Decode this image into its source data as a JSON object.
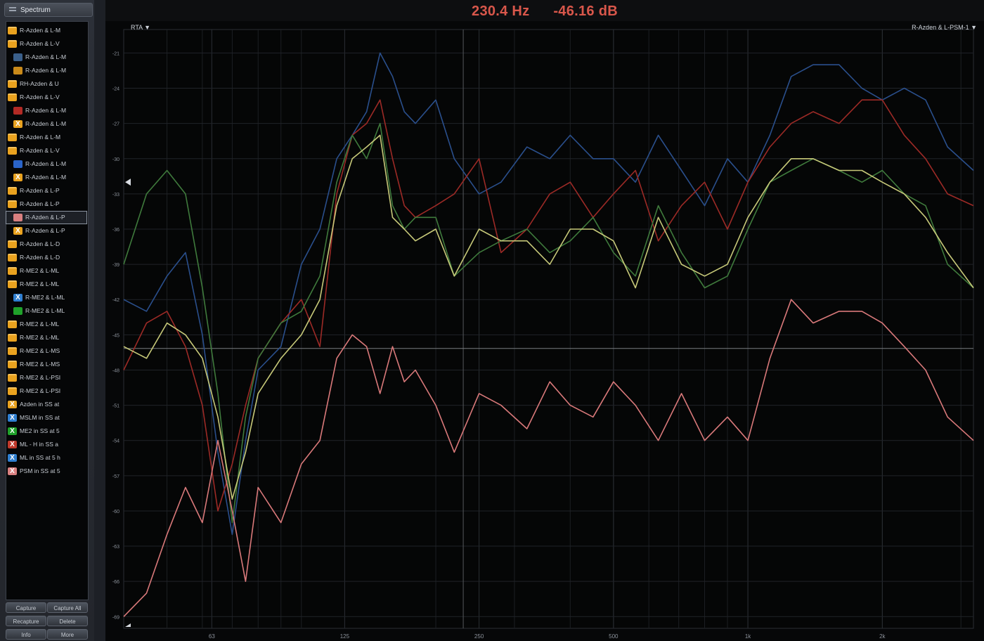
{
  "sidebar": {
    "title": "Spectrum",
    "items": [
      {
        "label": "R-Azden & L-M",
        "icon": "folder-icon",
        "color": "#e9a21f"
      },
      {
        "label": "R-Azden & L-V",
        "icon": "folder-icon",
        "color": "#e9a21f"
      },
      {
        "label": "R-Azden & L-M",
        "icon": "trace-swatch-icon",
        "color": "#3a5f8a",
        "indent": true
      },
      {
        "label": "R-Azden & L-M",
        "icon": "trace-swatch-icon",
        "color": "#c98a1a",
        "indent": true
      },
      {
        "label": "RH-Azden & U",
        "icon": "folder-icon",
        "color": "#e9a21f"
      },
      {
        "label": "R-Azden & L-V",
        "icon": "folder-icon",
        "color": "#e9a21f"
      },
      {
        "label": "R-Azden & L-M",
        "icon": "trace-swatch-icon",
        "color": "#b22a25",
        "indent": true
      },
      {
        "label": "R-Azden & L-M",
        "icon": "x-swatch-icon",
        "color": "#e9a21f",
        "indent": true
      },
      {
        "label": "R-Azden & L-M",
        "icon": "folder-icon",
        "color": "#e9a21f"
      },
      {
        "label": "R-Azden & L-V",
        "icon": "folder-icon",
        "color": "#e9a21f"
      },
      {
        "label": "R-Azden & L-M",
        "icon": "trace-swatch-icon",
        "color": "#2a64c8",
        "indent": true
      },
      {
        "label": "R-Azden & L-M",
        "icon": "x-swatch-icon",
        "color": "#e9a21f",
        "indent": true
      },
      {
        "label": "R-Azden & L-P",
        "icon": "folder-icon",
        "color": "#e9a21f"
      },
      {
        "label": "R-Azden & L-P",
        "icon": "folder-icon",
        "color": "#e9a21f"
      },
      {
        "label": "R-Azden & L-P",
        "icon": "trace-swatch-icon",
        "color": "#d98080",
        "indent": true,
        "selected": true
      },
      {
        "label": "R-Azden & L-P",
        "icon": "x-swatch-icon",
        "color": "#e9a21f",
        "indent": true
      },
      {
        "label": "R-Azden & L-D",
        "icon": "folder-icon",
        "color": "#e9a21f"
      },
      {
        "label": "R-Azden & L-D",
        "icon": "folder-icon",
        "color": "#e9a21f"
      },
      {
        "label": "R-ME2 & L-ML",
        "icon": "folder-icon",
        "color": "#e9a21f"
      },
      {
        "label": "R-ME2 & L-ML",
        "icon": "folder-icon",
        "color": "#e9a21f"
      },
      {
        "label": "R-ME2 & L-ML",
        "icon": "x-swatch-icon",
        "color": "#2f7fd0",
        "indent": true
      },
      {
        "label": "R-ME2 & L-ML",
        "icon": "trace-swatch-icon",
        "color": "#1fa12a",
        "indent": true
      },
      {
        "label": "R-ME2 & L-ML",
        "icon": "folder-icon",
        "color": "#e9a21f"
      },
      {
        "label": "R-ME2 & L-ML",
        "icon": "folder-icon",
        "color": "#e9a21f"
      },
      {
        "label": "R-ME2 & L-MS",
        "icon": "folder-icon",
        "color": "#e9a21f"
      },
      {
        "label": "R-ME2 & L-MS",
        "icon": "folder-icon",
        "color": "#e9a21f"
      },
      {
        "label": "R-ME2 & L-PSI",
        "icon": "folder-icon",
        "color": "#e9a21f"
      },
      {
        "label": "R-ME2 & L-PSI",
        "icon": "folder-icon",
        "color": "#e9a21f"
      },
      {
        "label": "Azden in SS at",
        "icon": "x-swatch-icon",
        "color": "#e9a21f"
      },
      {
        "label": "MSLM in SS at",
        "icon": "x-swatch-icon",
        "color": "#2f7fd0"
      },
      {
        "label": "ME2 in SS at 5",
        "icon": "x-swatch-icon",
        "color": "#1fa12a"
      },
      {
        "label": "ML - H in SS a",
        "icon": "x-swatch-icon",
        "color": "#c0392b"
      },
      {
        "label": "ML in SS at 5 h",
        "icon": "x-swatch-icon",
        "color": "#2f7fd0"
      },
      {
        "label": "PSM in SS at 5",
        "icon": "x-swatch-icon",
        "color": "#d98080"
      }
    ],
    "buttons": {
      "capture": "Capture",
      "capture_all": "Capture All",
      "recapture": "Recapture",
      "delete": "Delete",
      "info": "Info",
      "more": "More"
    }
  },
  "readout": {
    "frequency": "230.4 Hz",
    "level": "-46.16 dB"
  },
  "plot": {
    "left_dropdown": "RTA ▼",
    "right_dropdown": "R-Azden & L-PSM-1 ▼",
    "y_ticks": [
      "-21",
      "-24",
      "-27",
      "-30",
      "-33",
      "-36",
      "-39",
      "-42",
      "-45",
      "-48",
      "-51",
      "-54",
      "-57",
      "-60",
      "-63",
      "-66",
      "-69"
    ],
    "x_ticks": [
      "63",
      "125",
      "250",
      "500",
      "1k",
      "2k"
    ]
  },
  "chart_data": {
    "type": "line",
    "xlabel": "",
    "ylabel": "",
    "x_scale": "log",
    "xlim": [
      40,
      3200
    ],
    "ylim": [
      -70,
      -19
    ],
    "cursor": {
      "x": 230.4,
      "y": -46.16
    },
    "grid": true,
    "x_ticks": [
      63,
      125,
      250,
      500,
      1000,
      2000
    ],
    "y_ticks": [
      -21,
      -24,
      -27,
      -30,
      -33,
      -36,
      -39,
      -42,
      -45,
      -48,
      -51,
      -54,
      -57,
      -60,
      -63,
      -66,
      -69
    ],
    "series": [
      {
        "color": "#2a4f8c",
        "x": [
          40,
          45,
          50,
          55,
          60,
          65,
          70,
          75,
          80,
          90,
          100,
          110,
          120,
          130,
          140,
          150,
          160,
          170,
          180,
          200,
          220,
          250,
          280,
          320,
          360,
          400,
          450,
          500,
          560,
          630,
          710,
          800,
          900,
          1000,
          1120,
          1250,
          1400,
          1600,
          1800,
          2000,
          2240,
          2500,
          2800,
          3200
        ],
        "y": [
          -42,
          -43,
          -40,
          -38,
          -45,
          -55,
          -62,
          -54,
          -48,
          -46,
          -39,
          -36,
          -30,
          -28,
          -26,
          -21,
          -23,
          -26,
          -27,
          -25,
          -30,
          -33,
          -32,
          -29,
          -30,
          -28,
          -30,
          -30,
          -32,
          -28,
          -31,
          -34,
          -30,
          -32,
          -28,
          -23,
          -22,
          -22,
          -24,
          -25,
          -24,
          -25,
          -29,
          -31
        ]
      },
      {
        "color": "#9c2a26",
        "x": [
          40,
          45,
          50,
          55,
          60,
          65,
          70,
          75,
          80,
          90,
          100,
          110,
          120,
          130,
          140,
          150,
          160,
          170,
          180,
          200,
          220,
          250,
          280,
          320,
          360,
          400,
          450,
          500,
          560,
          630,
          710,
          800,
          900,
          1000,
          1120,
          1250,
          1400,
          1600,
          1800,
          2000,
          2240,
          2500,
          2800,
          3200
        ],
        "y": [
          -48,
          -44,
          -43,
          -46,
          -51,
          -60,
          -56,
          -51,
          -47,
          -44,
          -42,
          -46,
          -33,
          -28,
          -27,
          -25,
          -30,
          -34,
          -35,
          -34,
          -33,
          -30,
          -38,
          -36,
          -33,
          -32,
          -35,
          -33,
          -31,
          -37,
          -34,
          -32,
          -36,
          -32,
          -29,
          -27,
          -26,
          -27,
          -25,
          -25,
          -28,
          -30,
          -33,
          -34
        ]
      },
      {
        "color": "#3f7a3c",
        "x": [
          40,
          45,
          50,
          55,
          60,
          65,
          70,
          75,
          80,
          90,
          100,
          110,
          120,
          130,
          140,
          150,
          160,
          170,
          180,
          200,
          220,
          250,
          280,
          320,
          360,
          400,
          450,
          500,
          560,
          630,
          710,
          800,
          900,
          1000,
          1120,
          1250,
          1400,
          1600,
          1800,
          2000,
          2240,
          2500,
          2800,
          3200
        ],
        "y": [
          -39,
          -33,
          -31,
          -33,
          -41,
          -50,
          -61,
          -52,
          -47,
          -44,
          -43,
          -40,
          -32,
          -28,
          -30,
          -27,
          -34,
          -36,
          -35,
          -35,
          -40,
          -38,
          -37,
          -36,
          -38,
          -37,
          -35,
          -38,
          -40,
          -34,
          -38,
          -41,
          -40,
          -36,
          -32,
          -31,
          -30,
          -31,
          -32,
          -31,
          -33,
          -34,
          -39,
          -41
        ]
      },
      {
        "color": "#c7c979",
        "x": [
          40,
          45,
          50,
          55,
          60,
          65,
          70,
          75,
          80,
          90,
          100,
          110,
          120,
          130,
          140,
          150,
          160,
          170,
          180,
          200,
          220,
          250,
          280,
          320,
          360,
          400,
          450,
          500,
          560,
          630,
          710,
          800,
          900,
          1000,
          1120,
          1250,
          1400,
          1600,
          1800,
          2000,
          2240,
          2500,
          2800,
          3200
        ],
        "y": [
          -46,
          -47,
          -44,
          -45,
          -47,
          -52,
          -59,
          -55,
          -50,
          -47,
          -45,
          -42,
          -34,
          -30,
          -29,
          -28,
          -35,
          -36,
          -37,
          -36,
          -40,
          -36,
          -37,
          -37,
          -39,
          -36,
          -36,
          -37,
          -41,
          -35,
          -39,
          -40,
          -39,
          -35,
          -32,
          -30,
          -30,
          -31,
          -31,
          -32,
          -33,
          -35,
          -38,
          -41
        ]
      },
      {
        "color": "#d9797a",
        "x": [
          40,
          45,
          50,
          55,
          60,
          65,
          70,
          75,
          80,
          90,
          100,
          110,
          120,
          130,
          140,
          150,
          160,
          170,
          180,
          200,
          220,
          250,
          280,
          320,
          360,
          400,
          450,
          500,
          560,
          630,
          710,
          800,
          900,
          1000,
          1120,
          1250,
          1400,
          1600,
          1800,
          2000,
          2240,
          2500,
          2800,
          3200
        ],
        "y": [
          -69,
          -67,
          -62,
          -58,
          -61,
          -54,
          -60,
          -66,
          -58,
          -61,
          -56,
          -54,
          -47,
          -45,
          -46,
          -50,
          -46,
          -49,
          -48,
          -51,
          -55,
          -50,
          -51,
          -53,
          -49,
          -51,
          -52,
          -49,
          -51,
          -54,
          -50,
          -54,
          -52,
          -54,
          -47,
          -42,
          -44,
          -43,
          -43,
          -44,
          -46,
          -48,
          -52,
          -54
        ]
      }
    ]
  }
}
